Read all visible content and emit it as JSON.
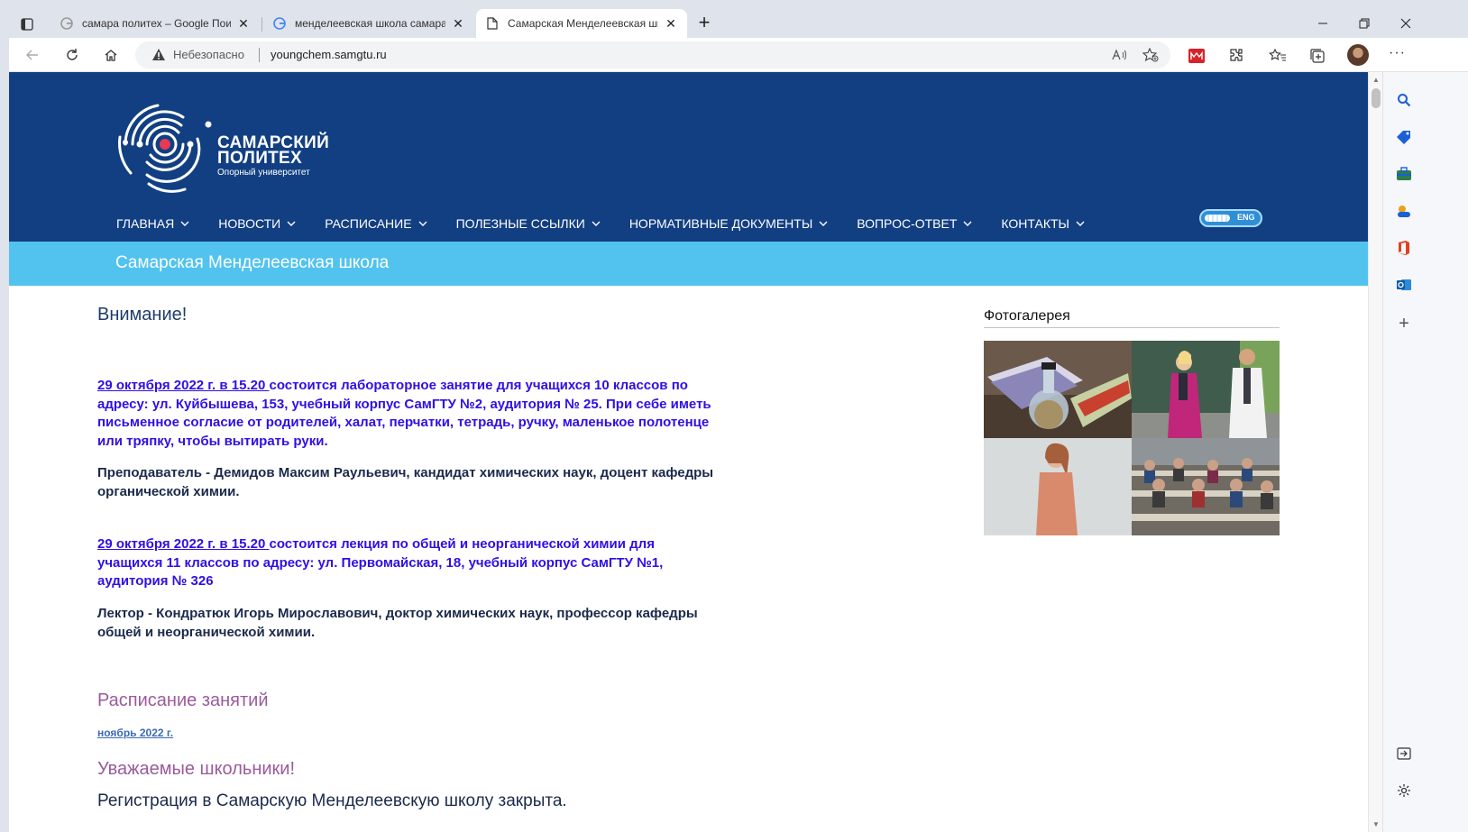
{
  "browser": {
    "tabs": [
      {
        "title": "самара политех – Google Поиск",
        "favicon": "google-icon"
      },
      {
        "title": "менделеевская школа самара -",
        "favicon": "google-icon"
      },
      {
        "title": "Самарская Менделеевская шко",
        "favicon": "page-icon",
        "active": true
      }
    ],
    "address": {
      "security_label": "Небезопасно",
      "url": "youngchem.samgtu.ru"
    }
  },
  "site": {
    "logo": {
      "line1": "САМАРСКИЙ",
      "line2": "ПОЛИТЕХ",
      "tagline": "Опорный университет"
    },
    "menu": [
      {
        "label": "ГЛАВНАЯ"
      },
      {
        "label": "НОВОСТИ"
      },
      {
        "label": "РАСПИСАНИЕ"
      },
      {
        "label": "ПОЛЕЗНЫЕ ССЫЛКИ"
      },
      {
        "label": "НОРМАТИВНЫЕ ДОКУМЕНТЫ"
      },
      {
        "label": "ВОПРОС-ОТВЕТ"
      },
      {
        "label": "КОНТАКТЫ"
      }
    ],
    "lang_toggle": "ENG",
    "subtitle": "Самарская Менделеевская школа"
  },
  "content": {
    "attention_heading": "Внимание!",
    "notice1": {
      "date": "29 октября 2022 г. в 15.20 ",
      "text": "состоится лабораторное занятие для учащихся 10 классов по адресу: ул. Куйбышева, 153, учебный корпус СамГТУ №2, аудитория № 25. При себе иметь письменное согласие от родителей, халат, перчатки, тетрадь, ручку, маленькое полотенце или тряпку, чтобы вытирать руки."
    },
    "teacher1": "Преподаватель - Демидов Максим Раульевич, кандидат химических наук, доцент кафедры органической химии.",
    "notice2": {
      "date": "29 октября 2022 г. в 15.20 ",
      "text": "состоится лекция по общей и неорганической химии для учащихся 11 классов по адресу: ул. Первомайская, 18, учебный корпус СамГТУ №1, аудитория № 326"
    },
    "teacher2": "Лектор - Кондратюк Игорь Мирославович, доктор химических наук, профессор кафедры общей и неорганической химии.",
    "schedule_heading": "Расписание занятий",
    "schedule_link": "ноябрь 2022 г.",
    "students_heading": "Уважаемые школьники!",
    "registration_text": "Регистрация в Самарскую Менделеевскую школу закрыта."
  },
  "gallery": {
    "title": "Фотогалерея"
  },
  "colors": {
    "header_blue": "#123f82",
    "subtitle_cyan": "#52c3ef",
    "notice_violet": "#2f0fe6",
    "heading_purple": "#9b5a9d"
  }
}
